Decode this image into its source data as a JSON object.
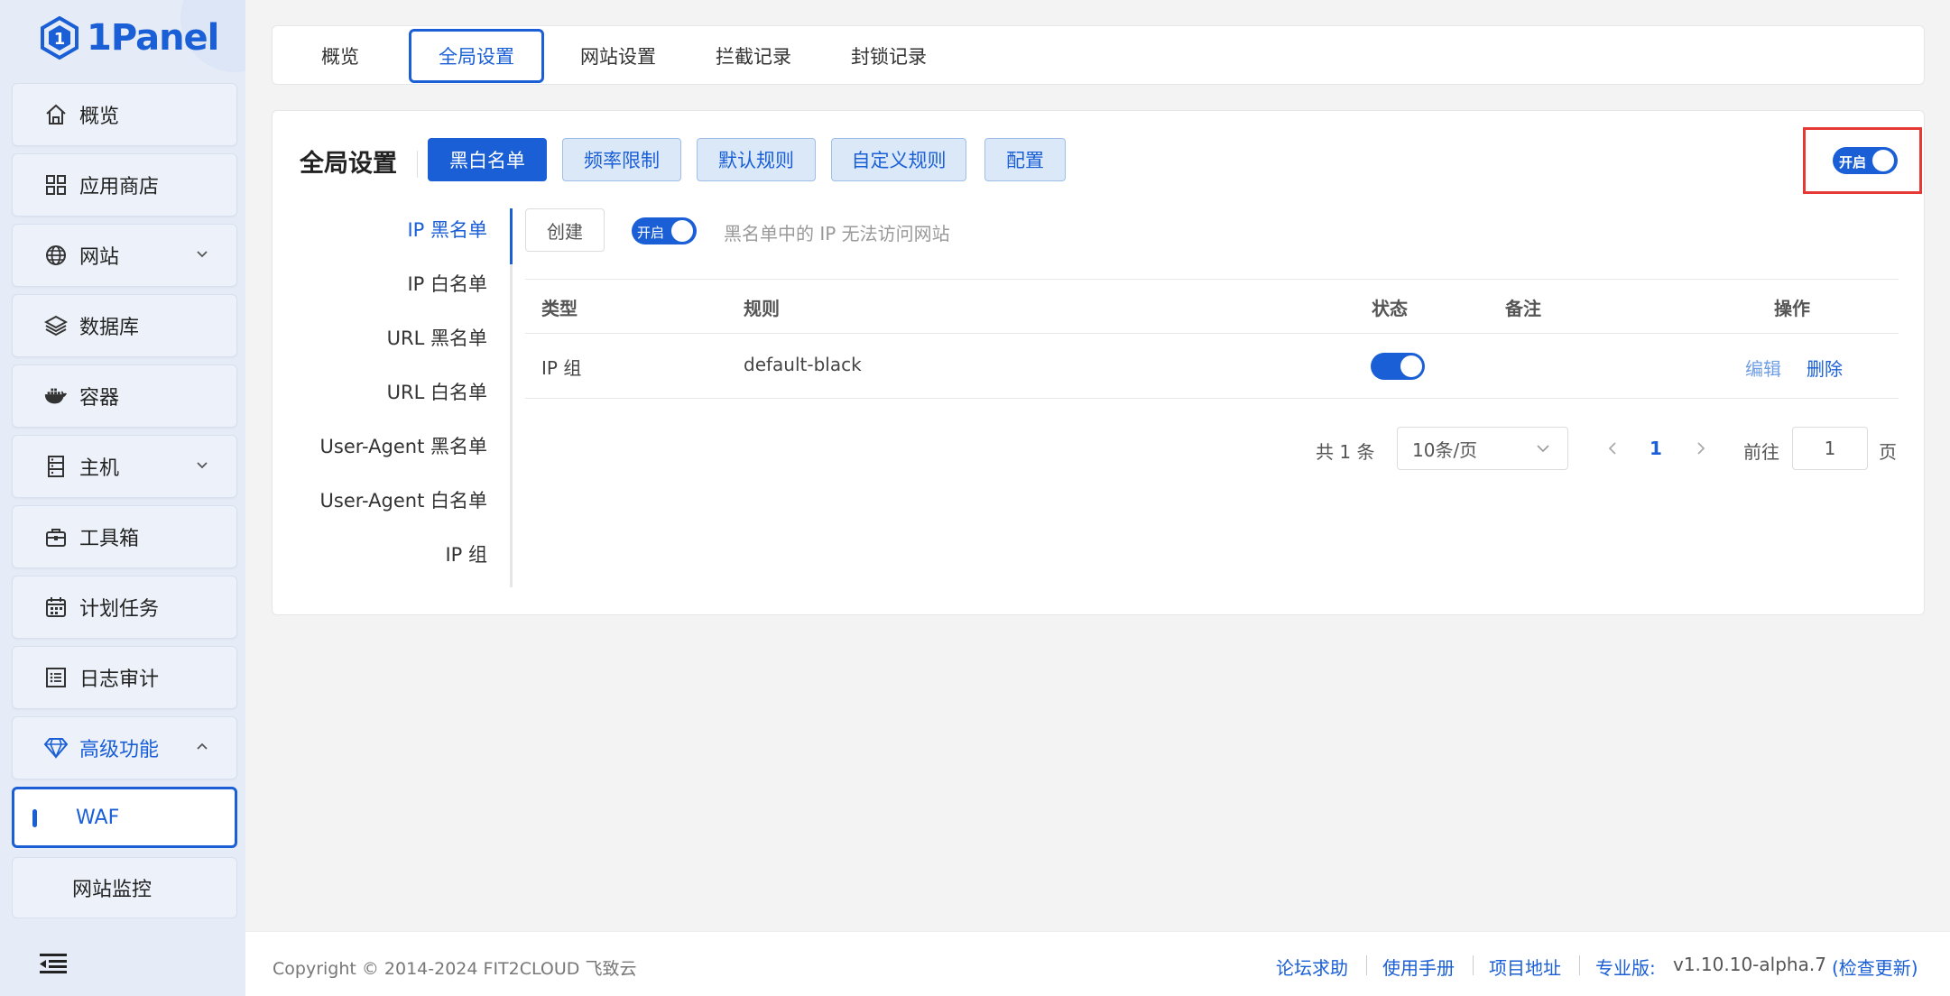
{
  "brand": {
    "logo_text": "1Panel"
  },
  "sidebar": {
    "items": [
      {
        "label": "概览"
      },
      {
        "label": "应用商店"
      },
      {
        "label": "网站"
      },
      {
        "label": "数据库"
      },
      {
        "label": "容器"
      },
      {
        "label": "主机"
      },
      {
        "label": "工具箱"
      },
      {
        "label": "计划任务"
      },
      {
        "label": "日志审计"
      },
      {
        "label": "高级功能"
      }
    ],
    "sub_items": [
      {
        "label": "WAF"
      },
      {
        "label": "网站监控"
      }
    ]
  },
  "top_tabs": [
    {
      "label": "概览"
    },
    {
      "label": "全局设置"
    },
    {
      "label": "网站设置"
    },
    {
      "label": "拦截记录"
    },
    {
      "label": "封锁记录"
    }
  ],
  "global": {
    "title": "全局设置",
    "sub_tabs": [
      {
        "label": "黑白名单"
      },
      {
        "label": "频率限制"
      },
      {
        "label": "默认规则"
      },
      {
        "label": "自定义规则"
      },
      {
        "label": "配置"
      }
    ],
    "main_toggle_label": "开启"
  },
  "side_menu": [
    {
      "label": "IP 黑名单"
    },
    {
      "label": "IP 白名单"
    },
    {
      "label": "URL 黑名单"
    },
    {
      "label": "URL 白名单"
    },
    {
      "label": "User-Agent 黑名单"
    },
    {
      "label": "User-Agent 白名单"
    },
    {
      "label": "IP 组"
    }
  ],
  "toolbar": {
    "create_label": "创建",
    "toggle_label": "开启",
    "hint": "黑名单中的 IP 无法访问网站"
  },
  "table": {
    "columns": [
      "类型",
      "规则",
      "状态",
      "备注",
      "操作"
    ],
    "rows": [
      {
        "type": "IP 组",
        "rule": "default-black",
        "status_on": true,
        "remark": "",
        "actions": [
          "编辑",
          "删除"
        ]
      }
    ]
  },
  "pager": {
    "total": "共 1 条",
    "page_size": "10条/页",
    "current": "1",
    "goto_label": "前往",
    "goto_value": "1",
    "page_unit": "页"
  },
  "footer": {
    "copyright": "Copyright © 2014-2024 FIT2CLOUD 飞致云",
    "links": [
      "论坛求助",
      "使用手册",
      "项目地址"
    ],
    "version_label": "专业版:",
    "version": "v1.10.10-alpha.7",
    "check_update": "(检查更新)"
  },
  "colors": {
    "accent": "#1a5fd6",
    "highlight": "#e53935",
    "sidebar_bg": "#e6ecf7"
  }
}
